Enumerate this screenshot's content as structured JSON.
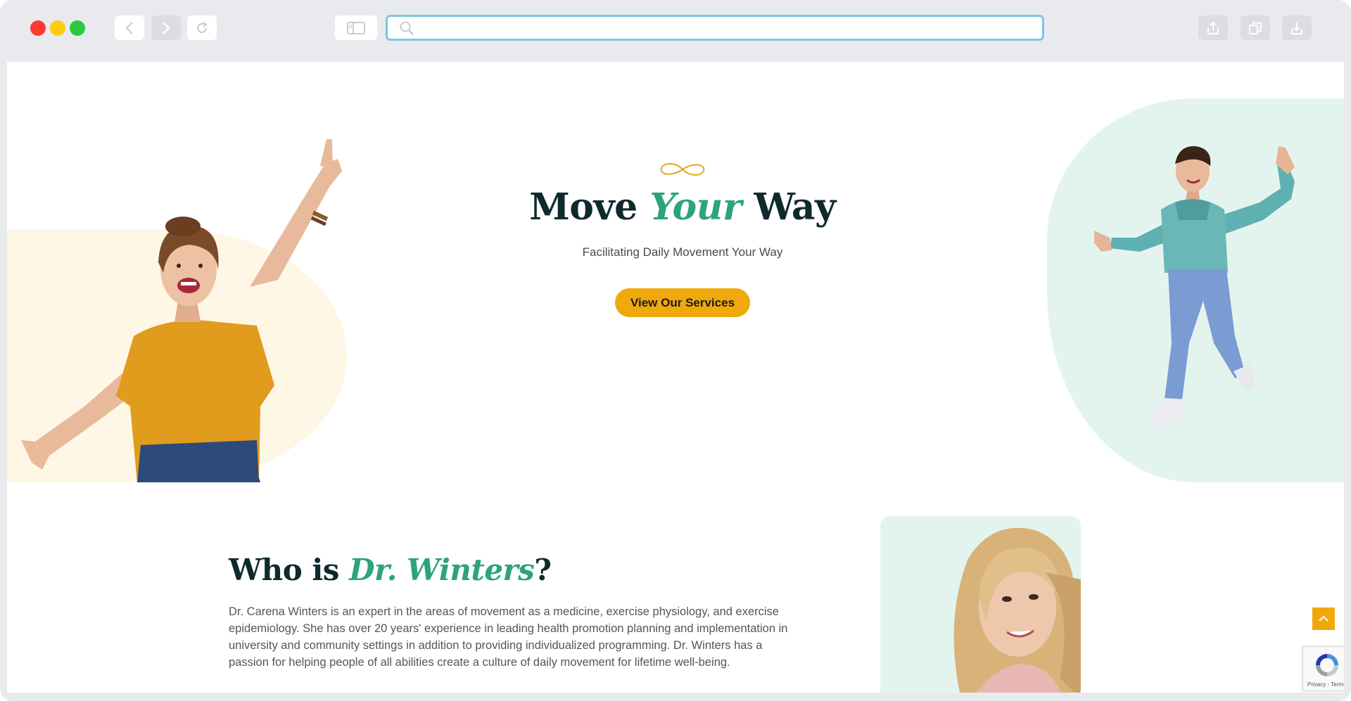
{
  "browser": {
    "url_value": "",
    "url_placeholder": ""
  },
  "hero": {
    "title_part1": "Move ",
    "title_accent": "Your",
    "title_part2": " Way",
    "subtitle": "Facilitating Daily Movement Your Way",
    "cta_label": "View Our Services"
  },
  "about": {
    "title_part1": "Who is ",
    "title_accent": "Dr. Winters",
    "title_part2": "?",
    "body": "Dr. Carena Winters is an expert in the areas of movement as a medicine, exercise physiology, and exercise epidemiology. She has over 20 years' experience in leading health promotion planning and implementation in university and community settings in addition to providing individualized programming. Dr. Winters has a passion for helping people of all abilities create a culture of daily movement for lifetime well-being."
  },
  "recaptcha": {
    "label": "Privacy - Terms"
  },
  "colors": {
    "accent_green": "#2da379",
    "accent_gold": "#f0a90d",
    "heading_dark": "#0f2a2c",
    "mint_bg": "#e3f4ee",
    "cream_bg": "#fff7e6"
  },
  "icons": [
    "back-icon",
    "forward-icon",
    "reload-icon",
    "sidebar-icon",
    "search-icon",
    "share-icon",
    "tabs-icon",
    "download-icon",
    "infinity-icon",
    "chevron-up-icon",
    "recaptcha-icon"
  ]
}
